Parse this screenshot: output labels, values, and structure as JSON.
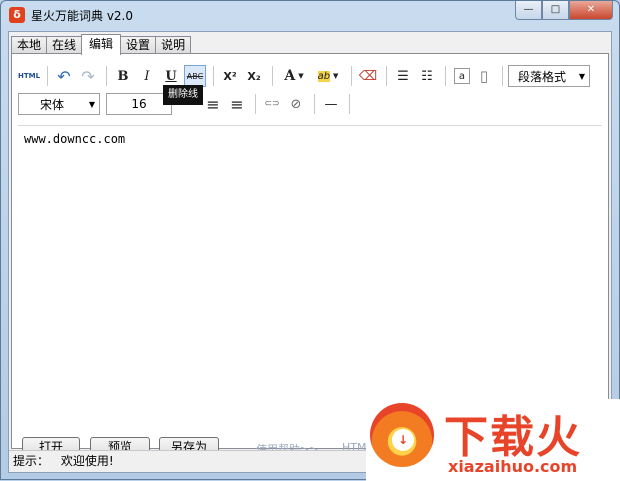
{
  "window": {
    "title": "星火万能词典 v2.0",
    "app_icon_glyph": "δ",
    "controls": {
      "minimize": "—",
      "maximize": "□",
      "close": "✕"
    }
  },
  "tabs": [
    {
      "label": "本地",
      "active": false
    },
    {
      "label": "在线",
      "active": false
    },
    {
      "label": "编辑",
      "active": true
    },
    {
      "label": "设置",
      "active": false
    },
    {
      "label": "说明",
      "active": false
    }
  ],
  "toolbar": {
    "html_label": "HTML",
    "undo_icon": "↶",
    "redo_icon": "↷",
    "bold": "B",
    "italic": "I",
    "underline": "U",
    "strike": "ABC",
    "superscript": "X²",
    "subscript": "X₂",
    "font_color": "A",
    "highlight": "ab",
    "eraser_icon": "⌫",
    "ordered_list_icon": "☰",
    "unordered_list_icon": "☷",
    "format_icon": "a",
    "page_icon": "▯",
    "paragraph_format": "段落格式",
    "font_family": "宋体",
    "font_size": "16",
    "align_center_icon": "≡",
    "align_right_icon": "≡",
    "link_icon": "⊂⊃",
    "unlink_icon": "⊘",
    "hr_icon": "—",
    "dropdown_arrow": "▼"
  },
  "tooltip": {
    "text": "删除线"
  },
  "editor": {
    "content": "www.downcc.com"
  },
  "bottom": {
    "open": "打开",
    "preview": "预览",
    "save_as": "另存为",
    "help_link": "使用帮助>>",
    "html_link": "HTM"
  },
  "status": {
    "label": "提示：",
    "message": "欢迎使用!"
  },
  "watermark": {
    "brand": "下载火",
    "url": "xiazaihuo.com"
  },
  "colors": {
    "accent": "#e8442a",
    "titlebar": "#c9dcef"
  }
}
